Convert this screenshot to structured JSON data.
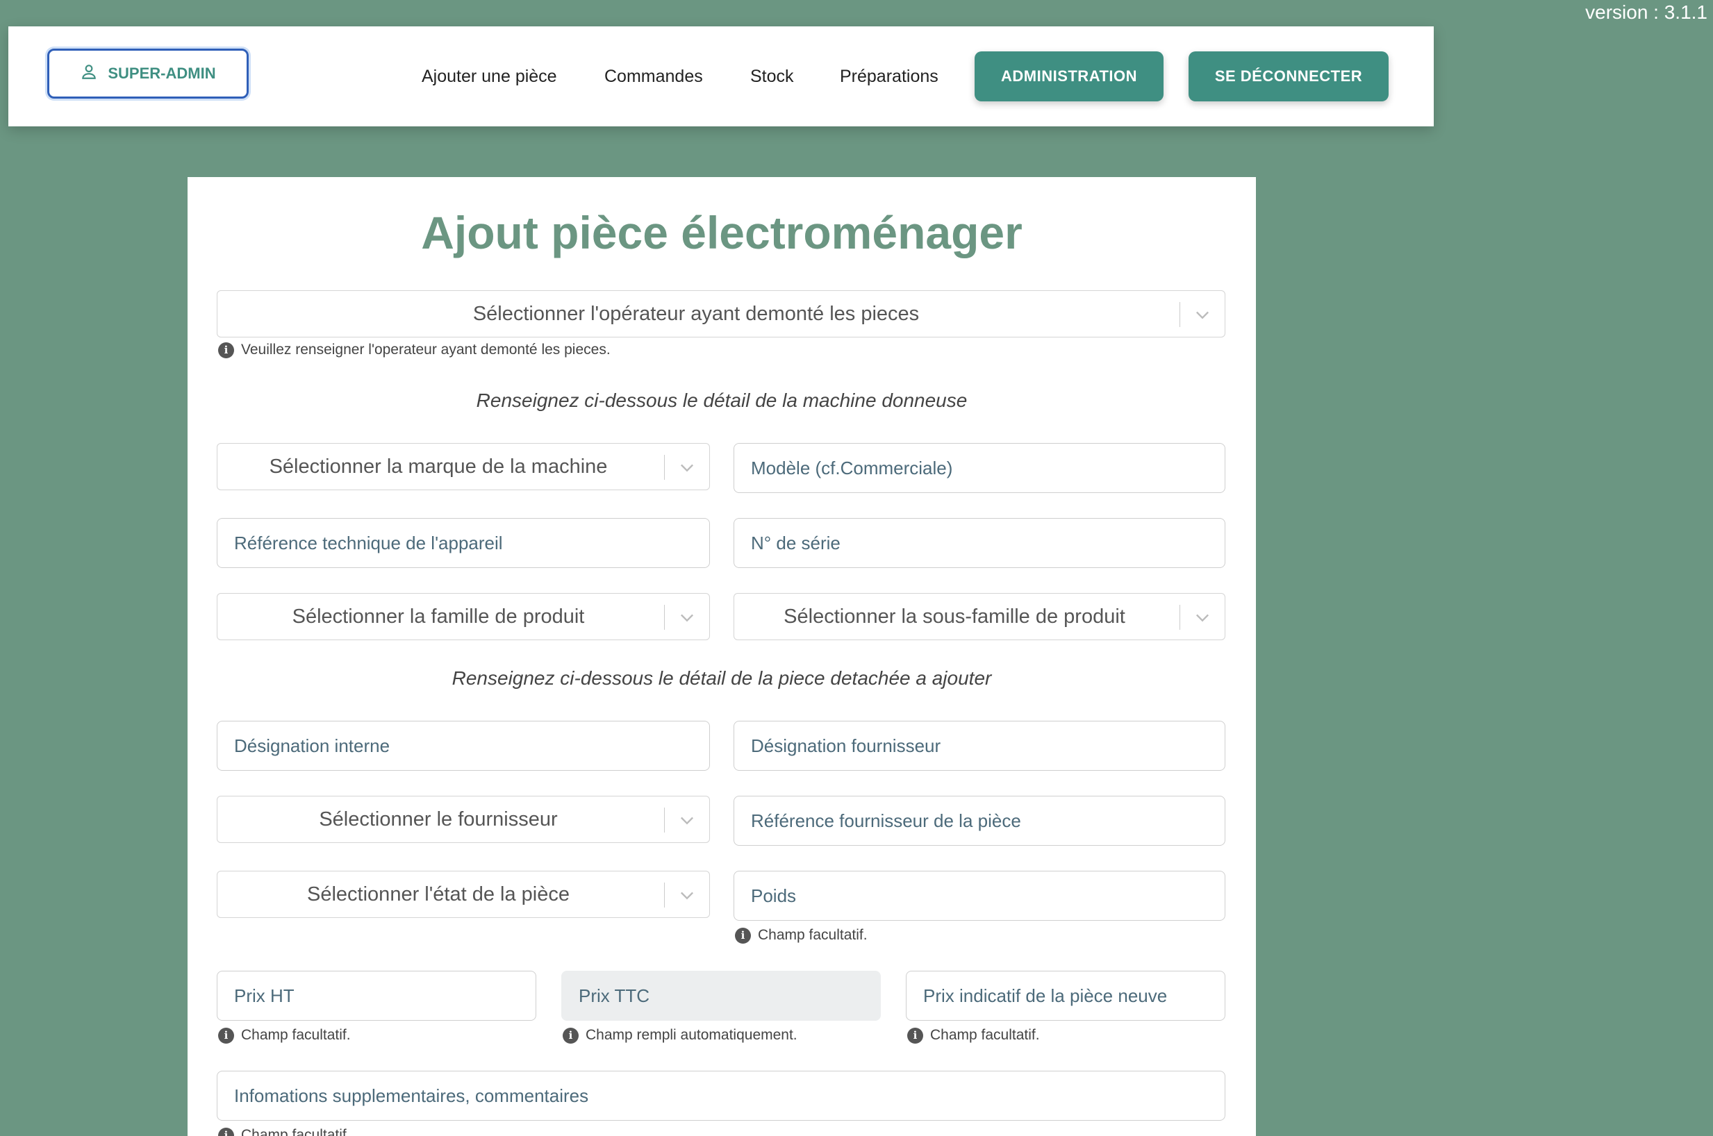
{
  "version_label": "version : 3.1.1",
  "nav": {
    "user_label": "SUPER-ADMIN",
    "links": [
      "Ajouter une pièce",
      "Commandes",
      "Stock",
      "Préparations"
    ],
    "admin_button": "ADMINISTRATION",
    "logout_button": "SE DÉCONNECTER"
  },
  "form": {
    "title": "Ajout pièce électroménager",
    "operator_select": "Sélectionner l'opérateur ayant demonté les pieces",
    "operator_hint": "Veuillez renseigner l'operateur ayant demonté les pieces.",
    "machine_section": "Renseignez ci-dessous le détail de la machine donneuse",
    "brand_select": "Sélectionner la marque de la machine",
    "model_placeholder": "Modèle (cf.Commerciale)",
    "tech_ref_placeholder": "Référence technique de l'appareil",
    "serial_placeholder": "N° de série",
    "family_select": "Sélectionner la famille de produit",
    "subfamily_select": "Sélectionner la sous-famille de produit",
    "part_section": "Renseignez ci-dessous le détail de la piece detachée a ajouter",
    "internal_designation": "Désignation interne",
    "supplier_designation": "Désignation fournisseur",
    "supplier_select": "Sélectionner le fournisseur",
    "supplier_ref": "Référence fournisseur de la pièce",
    "state_select": "Sélectionner l'état de la pièce",
    "weight": "Poids",
    "weight_hint": "Champ facultatif.",
    "price_ht": "Prix HT",
    "price_ht_hint": "Champ facultatif.",
    "price_ttc": "Prix TTC",
    "price_ttc_hint": "Champ rempli automatiquement.",
    "price_new": "Prix indicatif de la pièce neuve",
    "price_new_hint": "Champ facultatif.",
    "comments": "Infomations supplementaires, commentaires",
    "comments_hint": "Champ facultatif."
  },
  "colors": {
    "background": "#6b9682",
    "accent": "#3f8f82",
    "title": "#6b9682"
  },
  "icons": {
    "user": "user-icon",
    "dropdown": "chevron-down-icon",
    "info": "info-icon"
  }
}
